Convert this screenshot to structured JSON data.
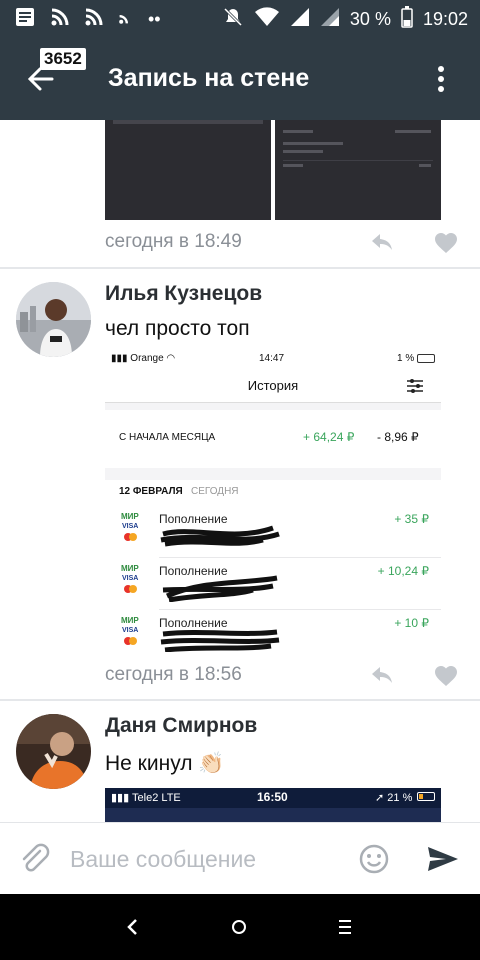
{
  "status_bar": {
    "battery": "30 %",
    "time": "19:02"
  },
  "header": {
    "badge_count": "3652",
    "title": "Запись на стене"
  },
  "comments": [
    {
      "time": "сегодня в 18:49"
    },
    {
      "author": "Илья Кузнецов",
      "text": "чел просто топ",
      "time": "сегодня в 18:56",
      "screenshot": {
        "carrier": "Orange",
        "time": "14:47",
        "battery": "1 %",
        "title": "История",
        "summary_label": "С НАЧАЛА МЕСЯЦА",
        "summary_in": "+ 64,24 ₽",
        "summary_out": "- 8,96 ₽",
        "date_label": "12 ФЕВРАЛЯ",
        "date_sub": "СЕГОДНЯ",
        "transactions": [
          {
            "label": "Пополнение",
            "amount": "+ 35 ₽"
          },
          {
            "label": "Пополнение",
            "amount": "+ 10,24 ₽"
          },
          {
            "label": "Пополнение",
            "amount": "+ 10 ₽"
          }
        ]
      }
    },
    {
      "author": "Даня Смирнов",
      "text": "Не кинул 👏🏻",
      "screenshot": {
        "carrier": "Tele2",
        "network": "LTE",
        "time": "16:50",
        "battery": "21 %"
      }
    }
  ],
  "input": {
    "placeholder": "Ваше сообщение"
  },
  "colors": {
    "header_bg": "#2f3b44",
    "accent_green": "#3aa55c",
    "meta_gray": "#8a8f96"
  }
}
